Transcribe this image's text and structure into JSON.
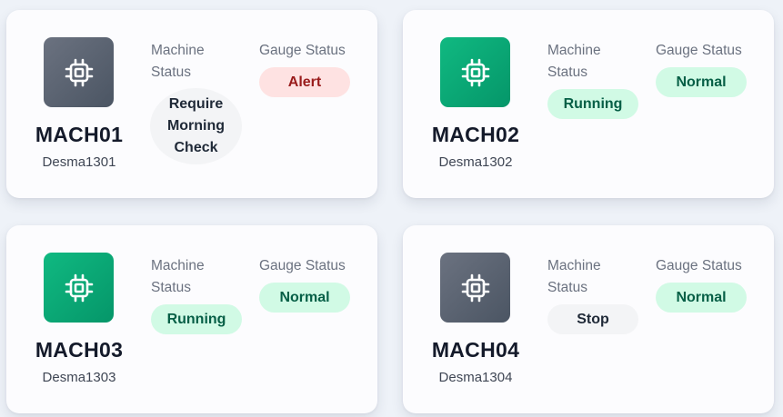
{
  "labels": {
    "machine_status": "Machine Status",
    "gauge_status": "Gauge Status"
  },
  "machines": [
    {
      "id": "MACH01",
      "sub": "Desma1301",
      "machine_status": "Require Morning Check",
      "gauge_status": "Alert",
      "icon": "chip-icon",
      "icon_color": "#5b616d"
    },
    {
      "id": "MACH02",
      "sub": "Desma1302",
      "machine_status": "Running",
      "gauge_status": "Normal",
      "icon": "chip-icon",
      "icon_color": "#0fa876"
    },
    {
      "id": "MACH03",
      "sub": "Desma1303",
      "machine_status": "Running",
      "gauge_status": "Normal",
      "icon": "chip-icon",
      "icon_color": "#0fa876"
    },
    {
      "id": "MACH04",
      "sub": "Desma1304",
      "machine_status": "Stop",
      "gauge_status": "Normal",
      "icon": "chip-icon",
      "icon_color": "#5b616d"
    }
  ],
  "colors": {
    "normal_bg": "#d1fae5",
    "normal_text": "#065f46",
    "alert_bg": "#fee2e2",
    "alert_text": "#991b1b",
    "neutral_bg": "#f3f4f6"
  }
}
